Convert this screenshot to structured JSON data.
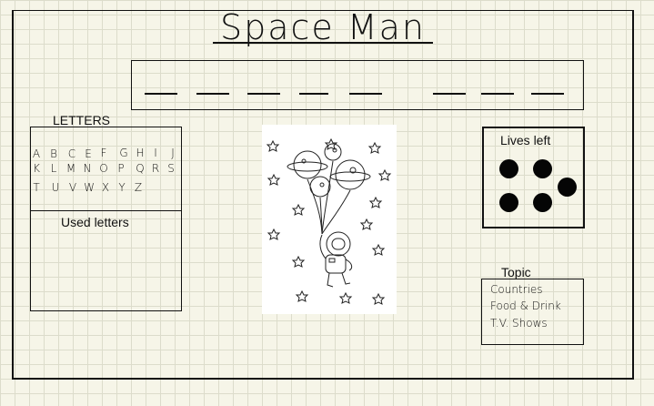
{
  "title": "Space Man",
  "word": {
    "blank_count": 8
  },
  "letters": {
    "heading": "LETTERS",
    "alphabet": [
      "A",
      "B",
      "C",
      "E",
      "F",
      "G",
      "H",
      "I",
      "J",
      "K",
      "L",
      "M",
      "N",
      "O",
      "P",
      "Q",
      "R",
      "S",
      "T",
      "U",
      "V",
      "W",
      "X",
      "Y",
      "Z"
    ],
    "used_heading": "Used letters"
  },
  "lives": {
    "heading": "Lives left",
    "remaining": 5
  },
  "topic": {
    "heading": "Topic",
    "items": [
      "Countries",
      "Food & Drink",
      "T.V. Shows"
    ]
  },
  "illustration": {
    "subject": "astronaut-with-planet-balloons"
  }
}
